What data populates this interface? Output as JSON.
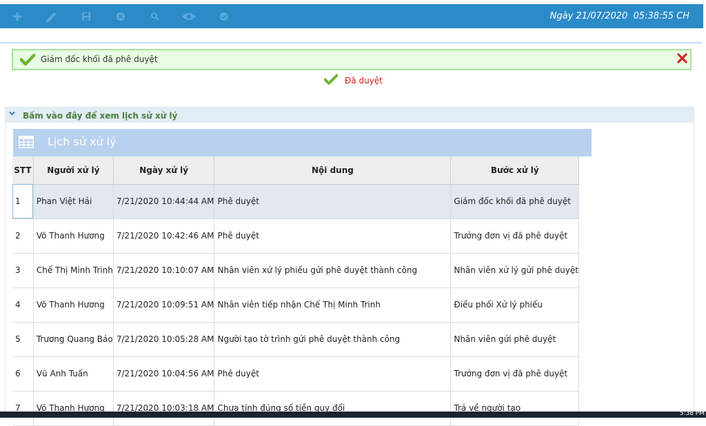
{
  "toolbar": {
    "datetime": "Ngày 21/07/2020  05:38:55 CH",
    "icons": [
      "add-icon",
      "edit-icon",
      "save-icon",
      "cancel-icon",
      "search-icon",
      "view-icon",
      "approve-icon"
    ]
  },
  "alert": {
    "message": "Giám đốc khối đã phê duyệt"
  },
  "status": {
    "label": "Đã duyệt"
  },
  "history": {
    "toggle_label": "Bấm vào đây để xem lịch sử xử lý",
    "table_title": "Lịch sử xử lý",
    "columns": [
      "STT",
      "Người xử lý",
      "Ngày xử lý",
      "Nội dung",
      "Bước xử lý"
    ],
    "rows": [
      [
        "1",
        "Phan Việt Hải",
        "7/21/2020 10:44:44 AM",
        "Phê duyệt",
        "Giám đốc khối đã phê duyệt"
      ],
      [
        "2",
        "Võ Thanh Hương",
        "7/21/2020 10:42:46 AM",
        "Phê duyệt",
        "Trưởng đơn vị đã phê duyệt"
      ],
      [
        "3",
        "Chế Thị Minh Trinh",
        "7/21/2020 10:10:07 AM",
        "Nhân viên xử lý phiếu gửi phê duyệt thành công",
        "Nhân viên xử lý gửi phê duyệt"
      ],
      [
        "4",
        "Võ Thanh Hương",
        "7/21/2020 10:09:51 AM",
        "Nhân viên tiếp nhận Chế Thị Minh Trinh",
        "Điều phối Xử lý phiếu"
      ],
      [
        "5",
        "Trương Quang Bảo",
        "7/21/2020 10:05:28 AM",
        "Người tạo tờ trình gửi phê duyệt thành công",
        "Nhân viên gửi phê duyệt"
      ],
      [
        "6",
        "Vũ Anh Tuấn",
        "7/21/2020 10:04:56 AM",
        "Phê duyệt",
        "Trưởng đơn vị đã phê duyệt"
      ],
      [
        "7",
        "Võ Thanh Hương",
        "7/21/2020 10:03:18 AM",
        "Chưa tính đúng số tiền quy đổi",
        "Trả về người tạo"
      ]
    ]
  },
  "taskbar": {
    "clock": "5:38 PM"
  },
  "colors": {
    "toolbar_bg": "#2b8ac8",
    "alert_bg": "#e8fce2",
    "status_red": "#d0181c",
    "table_header_bar": "#b8d1ef"
  }
}
